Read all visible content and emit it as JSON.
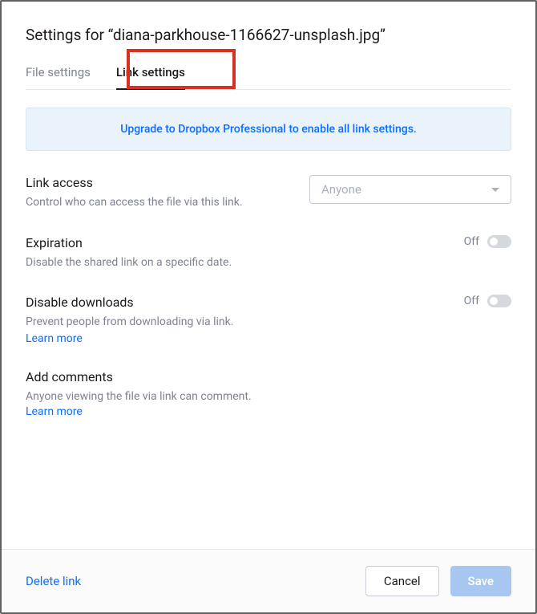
{
  "header": {
    "title": "Settings for “diana-parkhouse-1166627-unsplash.jpg”"
  },
  "tabs": {
    "file_settings": "File settings",
    "link_settings": "Link settings"
  },
  "banner": {
    "text": "Upgrade to Dropbox Professional to enable all link settings."
  },
  "link_access": {
    "title": "Link access",
    "desc": "Control who can access the file via this link.",
    "select_value": "Anyone"
  },
  "expiration": {
    "title": "Expiration",
    "desc": "Disable the shared link on a specific date.",
    "toggle_state": "Off"
  },
  "disable_downloads": {
    "title": "Disable downloads",
    "desc": "Prevent people from downloading via link.",
    "learn_more": "Learn more",
    "toggle_state": "Off"
  },
  "add_comments": {
    "title": "Add comments",
    "desc_prefix": "Anyone viewing the file via link can comment. ",
    "learn_more": "Learn more"
  },
  "footer": {
    "delete_link": "Delete link",
    "cancel": "Cancel",
    "save": "Save"
  }
}
